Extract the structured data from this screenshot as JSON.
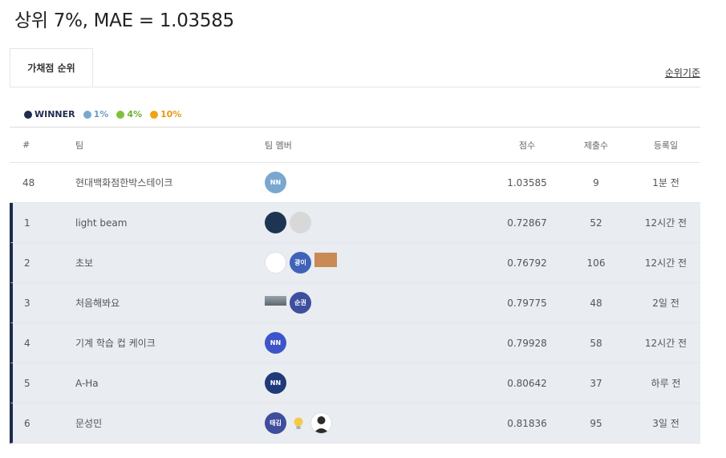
{
  "headline": "상위 7%, MAE = 1.03585",
  "tabs": {
    "active": "가채점 순위",
    "rank_basis": "순위기준"
  },
  "legend": [
    {
      "label": "WINNER",
      "color": "#1d2c4d",
      "text_color": "#1d2c4d"
    },
    {
      "label": "1%",
      "color": "#7aa7cf",
      "text_color": "#6a9ccc"
    },
    {
      "label": "4%",
      "color": "#7ec13c",
      "text_color": "#6fb12d"
    },
    {
      "label": "10%",
      "color": "#f1a315",
      "text_color": "#e99a0d"
    }
  ],
  "columns": {
    "rank": "#",
    "team": "팀",
    "members": "팀 멤버",
    "score": "점수",
    "submissions": "제출수",
    "date": "등록일"
  },
  "my_row": {
    "rank": "48",
    "team": "현대백화점한박스테이크",
    "avatars": [
      {
        "label": "NN",
        "color": "#7aa7cf"
      }
    ],
    "score": "1.03585",
    "submissions": "9",
    "date": "1분 전"
  },
  "rows": [
    {
      "rank": "1",
      "team": "light beam",
      "score": "0.72867",
      "submissions": "52",
      "date": "12시간 전"
    },
    {
      "rank": "2",
      "team": "초보",
      "score": "0.76792",
      "submissions": "106",
      "date": "12시간 전"
    },
    {
      "rank": "3",
      "team": "처음해봐요",
      "score": "0.79775",
      "submissions": "48",
      "date": "2일 전"
    },
    {
      "rank": "4",
      "team": "기계 학습 컵 케이크",
      "score": "0.79928",
      "submissions": "58",
      "date": "12시간 전"
    },
    {
      "rank": "5",
      "team": "A-Ha",
      "score": "0.80642",
      "submissions": "37",
      "date": "하루 전"
    },
    {
      "rank": "6",
      "team": "문성민",
      "score": "0.81836",
      "submissions": "95",
      "date": "3일 전"
    }
  ],
  "avatar_labels": {
    "gwang": "광이",
    "soon": "순권",
    "nn4": "NN",
    "nn5": "NN",
    "tae": "태김"
  },
  "colors": {
    "winner_bar": "#1d2c4d",
    "winner_bg": "#e9ecf1",
    "nn4": "#3d55c8",
    "nn5": "#1f3a78",
    "gwang": "#3e63b8",
    "soon": "#3f4fa0",
    "tae": "#3e4d9c"
  },
  "icons": {
    "row1": [
      "sky-photo-icon",
      "sketch-photo-icon"
    ],
    "row2": [
      "blank-avatar-icon",
      "orange-bear-icon"
    ],
    "row3": [
      "landscape-photo-icon"
    ],
    "row6": [
      "lightbulb-icon",
      "person-photo-icon"
    ]
  }
}
